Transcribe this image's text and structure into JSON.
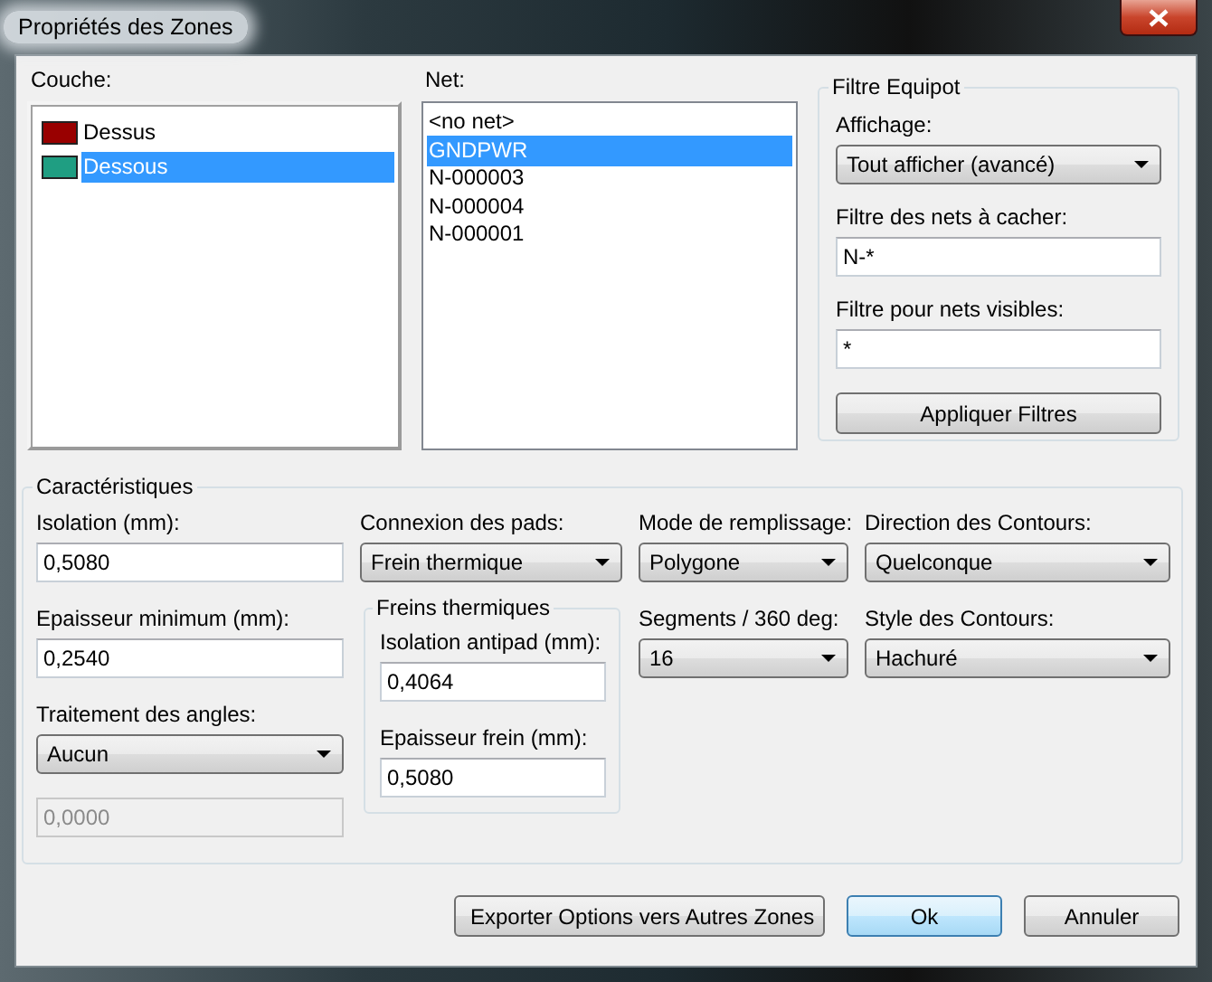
{
  "window": {
    "title": "Propriétés des Zones"
  },
  "layer_list": {
    "label": "Couche:",
    "items": [
      {
        "name": "Dessus",
        "color": "#990000",
        "selected": false
      },
      {
        "name": "Dessous",
        "color": "#1f9e82",
        "selected": true
      }
    ]
  },
  "net_list": {
    "label": "Net:",
    "items": [
      {
        "name": "<no net>",
        "selected": false
      },
      {
        "name": "GNDPWR",
        "selected": true
      },
      {
        "name": "N-000003",
        "selected": false
      },
      {
        "name": "N-000004",
        "selected": false
      },
      {
        "name": "N-000001",
        "selected": false
      }
    ]
  },
  "equipot_filter": {
    "title": "Filtre Equipot",
    "items": [
      {
        "kind": "dropdown",
        "label": "Affichage:",
        "value": "Tout afficher (avancé)"
      },
      {
        "kind": "field",
        "label": "Filtre des nets à cacher:",
        "value": "N-*",
        "disabled": false
      },
      {
        "kind": "field",
        "label": "Filtre pour nets visibles:",
        "value": "*",
        "disabled": false
      },
      {
        "kind": "button",
        "label": "Appliquer Filtres"
      }
    ]
  },
  "characteristics": {
    "title": "Caractéristiques",
    "columns": [
      [
        {
          "kind": "field",
          "label": "Isolation (mm):",
          "value": "0,5080",
          "disabled": false
        },
        {
          "kind": "field",
          "label": "Epaisseur minimum (mm):",
          "value": "0,2540",
          "disabled": false
        },
        {
          "kind": "dropdown",
          "label": "Traitement des angles:",
          "value": "Aucun"
        },
        {
          "kind": "field",
          "value": "0,0000",
          "disabled": true
        }
      ],
      [
        {
          "kind": "dropdown",
          "label": "Connexion des pads:",
          "value": "Frein thermique"
        },
        {
          "kind": "group",
          "title": "Freins thermiques",
          "items": [
            {
              "kind": "field",
              "label": "Isolation antipad (mm):",
              "value": "0,4064",
              "disabled": false
            },
            {
              "kind": "field",
              "label": "Epaisseur frein (mm):",
              "value": "0,5080",
              "disabled": false
            }
          ]
        }
      ],
      [
        {
          "kind": "dropdown",
          "label": "Mode de remplissage:",
          "value": "Polygone"
        },
        {
          "kind": "dropdown",
          "label": "Segments / 360 deg:",
          "value": "16"
        }
      ],
      [
        {
          "kind": "dropdown",
          "label": "Direction des Contours:",
          "value": "Quelconque"
        },
        {
          "kind": "dropdown",
          "label": "Style des Contours:",
          "value": "Hachuré"
        }
      ]
    ]
  },
  "buttons": [
    {
      "label": "Exporter Options vers Autres Zones",
      "default": false
    },
    {
      "label": "Ok",
      "default": true
    },
    {
      "label": "Annuler",
      "default": false
    }
  ]
}
